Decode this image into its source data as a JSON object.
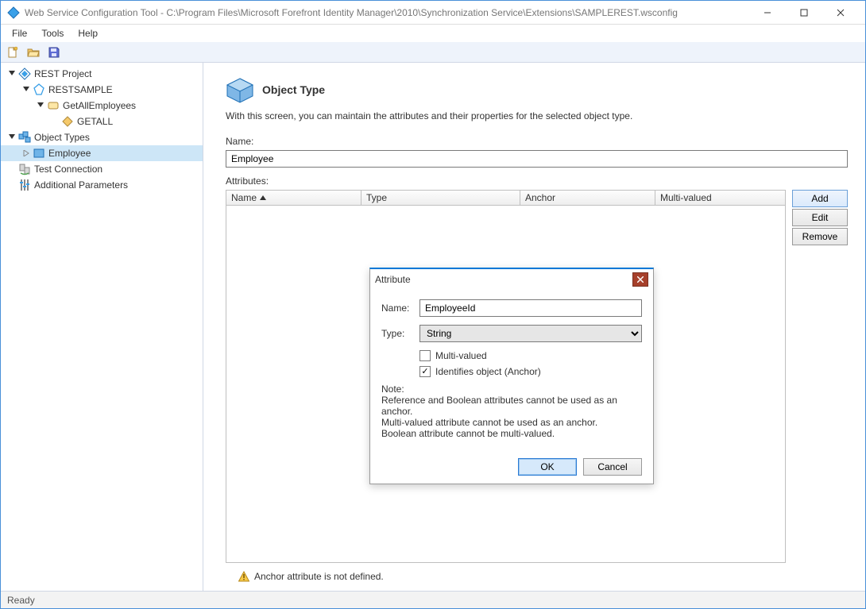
{
  "window": {
    "title": "Web Service Configuration Tool - C:\\Program Files\\Microsoft Forefront Identity Manager\\2010\\Synchronization Service\\Extensions\\SAMPLEREST.wsconfig"
  },
  "menu": {
    "file": "File",
    "tools": "Tools",
    "help": "Help"
  },
  "tree": {
    "rest_project": "REST Project",
    "restsample": "RESTSAMPLE",
    "getall_employees": "GetAllEmployees",
    "getall": "GETALL",
    "object_types": "Object Types",
    "employee": "Employee",
    "test_connection": "Test Connection",
    "additional_parameters": "Additional Parameters"
  },
  "page": {
    "title": "Object Type",
    "description": "With this screen, you can maintain the attributes and their properties for the selected object type.",
    "name_label": "Name:",
    "name_value": "Employee",
    "attributes_label": "Attributes:"
  },
  "grid": {
    "columns": {
      "name": "Name",
      "type": "Type",
      "anchor": "Anchor",
      "multi": "Multi-valued"
    }
  },
  "buttons": {
    "add": "Add",
    "edit": "Edit",
    "remove": "Remove"
  },
  "dialog": {
    "title": "Attribute",
    "name_label": "Name:",
    "name_value": "EmployeeId",
    "type_label": "Type:",
    "type_value": "String",
    "multi_label": "Multi-valued",
    "anchor_label": "Identifies object (Anchor)",
    "note_heading": "Note:",
    "note_line1": "Reference and Boolean attributes cannot be used as an anchor.",
    "note_line2": "Multi-valued attribute cannot be used as an anchor.",
    "note_line3": "Boolean attribute cannot be multi-valued.",
    "ok": "OK",
    "cancel": "Cancel"
  },
  "warning": "Anchor attribute is not defined.",
  "status": "Ready"
}
